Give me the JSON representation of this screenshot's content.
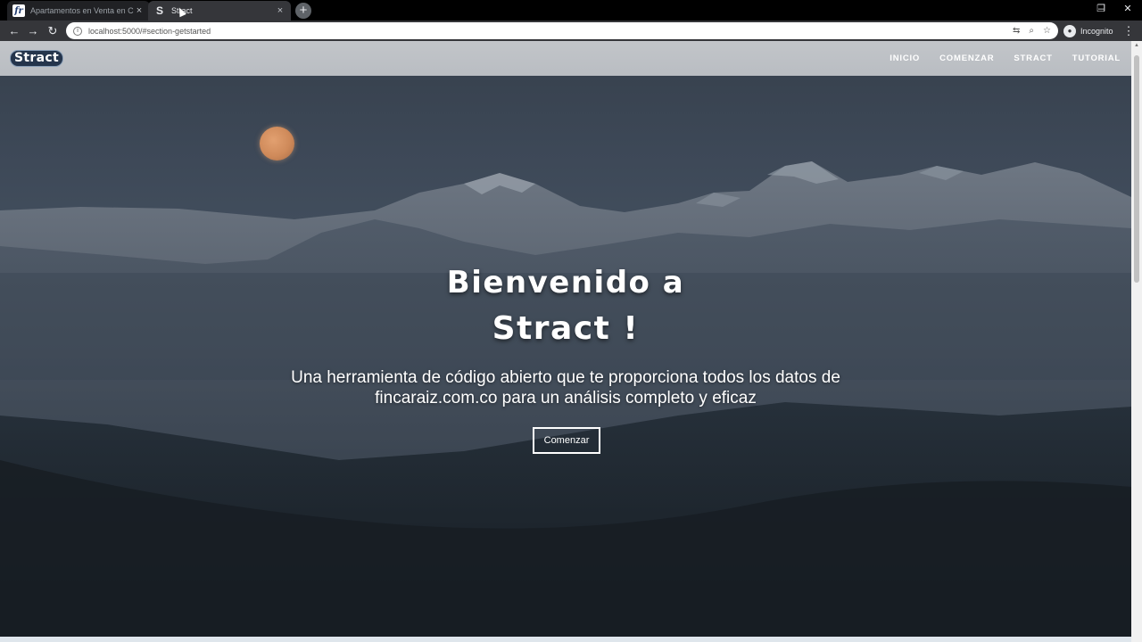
{
  "browser": {
    "tabs": [
      {
        "label": "Apartamentos en Venta en Caldas",
        "favicon": "fr",
        "active": false
      },
      {
        "label": "Stract",
        "favicon": "S",
        "active": true
      }
    ],
    "new_tab_icon": "+",
    "close_icon": "×",
    "url": "localhost:5000/#section-getstarted",
    "profile_label": "Incognito",
    "window_controls": {
      "minimize": "–",
      "restore": "❐",
      "close": "✕"
    }
  },
  "site": {
    "logo": "Stract",
    "nav": [
      "INICIO",
      "COMENZAR",
      "STRACT",
      "TUTORIAL"
    ]
  },
  "hero": {
    "title_line1": "Bienvenido a",
    "title_line2": "Stract !",
    "subtitle_line1": "Una herramienta de código abierto que te proporciona todos los datos de",
    "subtitle_line2": "fincaraiz.com.co para un análisis completo y eficaz",
    "cta": "Comenzar"
  },
  "colors": {
    "header_bg": "#bec2c7",
    "logo_bg": "#25354c",
    "sky_top": "#36404c",
    "forest": "#1b222a",
    "moon": "#d58f5e"
  }
}
